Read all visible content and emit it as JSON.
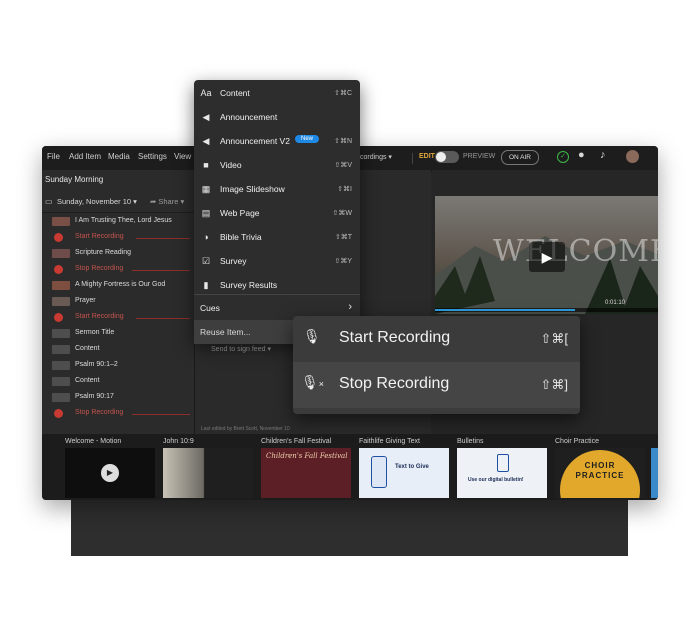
{
  "menubar": {
    "items": [
      "File",
      "Add Item",
      "Media",
      "Settings",
      "View"
    ],
    "recordings_label": "cordings",
    "edit_label": "EDIT",
    "preview_label": "PREVIEW",
    "on_air_label": "ON AIR"
  },
  "sidebar": {
    "title": "Sunday Morning",
    "date": "Sunday, November 10",
    "share_label": "Share",
    "items": [
      {
        "type": "item",
        "label": "I Am Trusting Thee, Lord Jesus",
        "thumb": "#7a4f45"
      },
      {
        "type": "cue",
        "label": "Start Recording"
      },
      {
        "type": "item",
        "label": "Scripture Reading",
        "thumb": "#6e4c4a"
      },
      {
        "type": "cue",
        "label": "Stop Recording"
      },
      {
        "type": "item",
        "label": "A Mighty Fortress is Our God",
        "thumb": "#7e4f41"
      },
      {
        "type": "item",
        "label": "Prayer",
        "thumb": "#6a5a54"
      },
      {
        "type": "cue",
        "label": "Start Recording"
      },
      {
        "type": "item",
        "label": "Sermon Title",
        "thumb": "#4e4e4e"
      },
      {
        "type": "item",
        "label": "Content",
        "thumb": "#4e4e4e"
      },
      {
        "type": "item",
        "label": "Psalm 90:1–2",
        "thumb": "#4e4e4e"
      },
      {
        "type": "item",
        "label": "Content",
        "thumb": "#4e4e4e"
      },
      {
        "type": "item",
        "label": "Psalm 90:17",
        "thumb": "#4e4e4e"
      },
      {
        "type": "cue",
        "label": "Stop Recording"
      }
    ]
  },
  "center": {
    "send_label": "Send to sign feed",
    "edited_label": "Last edited by Brett Scott, November 10",
    "clock_label": "lock"
  },
  "preview": {
    "slide_text": "WELCOME",
    "time": "0:01:10"
  },
  "dropdown": {
    "items": [
      {
        "icon": "Aa",
        "name": "content",
        "label": "Content",
        "shortcut": "⇧⌘C"
      },
      {
        "icon": "◀",
        "name": "announcement",
        "label": "Announcement",
        "shortcut": ""
      },
      {
        "icon": "◀",
        "name": "announcement-v2",
        "label": "Announcement V2",
        "shortcut": "⇧⌘N",
        "badge": "New"
      },
      {
        "icon": "■",
        "name": "video",
        "label": "Video",
        "shortcut": "⇧⌘V"
      },
      {
        "icon": "▦",
        "name": "image-slideshow",
        "label": "Image Slideshow",
        "shortcut": "⇧⌘I"
      },
      {
        "icon": "▤",
        "name": "web-page",
        "label": "Web Page",
        "shortcut": "⇧⌘W"
      },
      {
        "icon": "◑",
        "name": "bible-trivia",
        "label": "Bible Trivia",
        "shortcut": "⇧⌘T"
      },
      {
        "icon": "☑",
        "name": "survey",
        "label": "Survey",
        "shortcut": "⇧⌘Y"
      },
      {
        "icon": "▮",
        "name": "survey-results",
        "label": "Survey Results",
        "shortcut": ""
      }
    ],
    "cues_label": "Cues",
    "reuse_label": "Reuse Item..."
  },
  "submenu": {
    "items": [
      {
        "label": "Start Recording",
        "shortcut": "⇧⌘["
      },
      {
        "label": "Stop Recording",
        "shortcut": "⇧⌘]"
      }
    ]
  },
  "strip": {
    "items": [
      {
        "label": "Welcome - Motion"
      },
      {
        "label": "John 10:9"
      },
      {
        "label": "Children's Fall Festival"
      },
      {
        "label": "Faithlife Giving Text"
      },
      {
        "label": "Bulletins"
      },
      {
        "label": "Choir Practice"
      }
    ],
    "festival_title": "Children's Fall Festival",
    "giving_text": "Text to Give",
    "bulletin_text": "Use our digital bulletin!",
    "choir_title": "CHOIR PRACTICE"
  },
  "colors": {
    "accent": "#1e88e5",
    "cue": "#c83a32",
    "on_air": "#3a3a3a",
    "status_ok": "#3dbb46"
  }
}
